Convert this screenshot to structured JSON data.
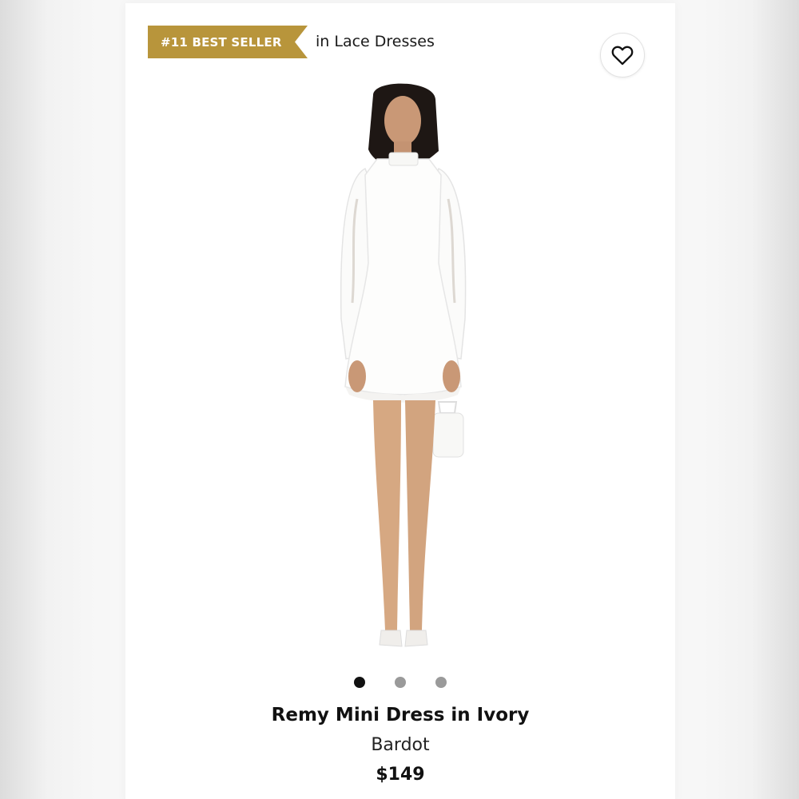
{
  "badge": {
    "label": "#11 BEST SELLER",
    "color": "#b8953b"
  },
  "category": "in Lace Dresses",
  "wishlist": {
    "icon": "heart-icon"
  },
  "gallery": {
    "image_icon": "product-photo",
    "dots": [
      true,
      false,
      false
    ]
  },
  "product": {
    "title": "Remy Mini Dress in Ivory",
    "brand": "Bardot",
    "price": "$149"
  }
}
